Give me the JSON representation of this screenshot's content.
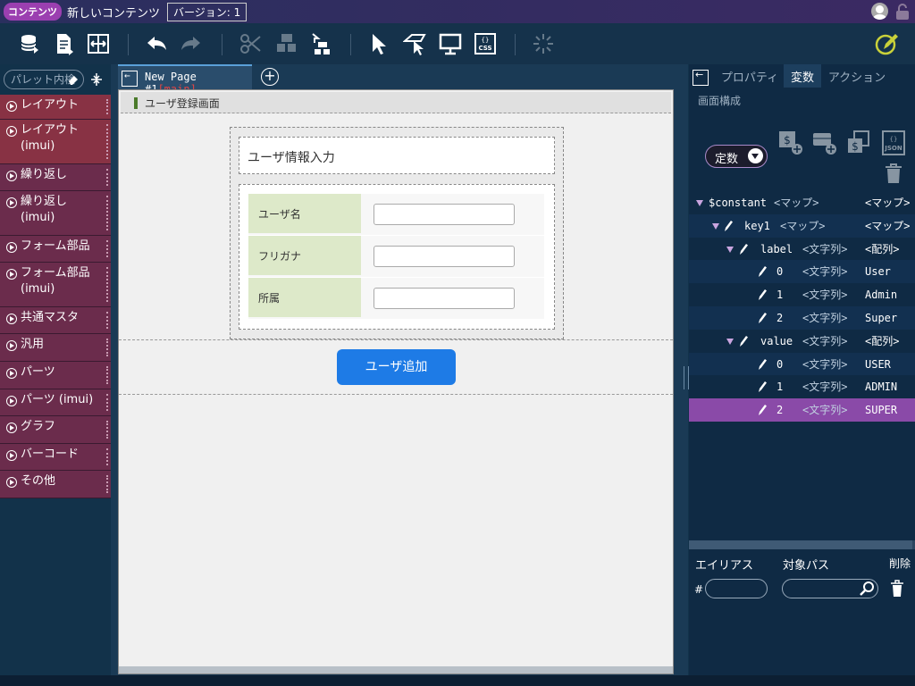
{
  "titlebar": {
    "badge": "コンテンツ",
    "title": "新しいコンテンツ",
    "version": "バージョン: 1",
    "icons": [
      "user-icon",
      "lock-icon"
    ]
  },
  "toolbar": {
    "buttons": [
      "database-icon",
      "document-icon",
      "resize-icon",
      "undo-icon",
      "redo-icon",
      "cut-icon",
      "copy-icon",
      "paste-icon",
      "select-icon",
      "pointer-icon",
      "preview-icon",
      "css-icon",
      "loading-icon",
      "edit-icon"
    ]
  },
  "palette": {
    "search_placeholder": "パレット内検",
    "items": [
      "レイアウト",
      "レイアウト\n(imui)",
      "繰り返し",
      "繰り返し\n(imui)",
      "フォーム部品",
      "フォーム部品\n(imui)",
      "共通マスタ",
      "汎用",
      "パーツ",
      "パーツ (imui)",
      "グラフ",
      "バーコード",
      "その他"
    ]
  },
  "editor": {
    "page_tab_name": "New Page #1",
    "page_tab_tag": "[main]",
    "screen_header": "ユーザ登録画面",
    "form_title": "ユーザ情報入力",
    "fields": [
      "ユーザ名",
      "フリガナ",
      "所属"
    ],
    "submit_button": "ユーザ追加"
  },
  "right_panel": {
    "tabs": [
      "プロパティ",
      "変数",
      "アクション"
    ],
    "active_tab": "変数",
    "sub_tab": "画面構成",
    "scope_select": "定数",
    "tree": [
      {
        "key": "$constant",
        "type": "<マップ>",
        "value": "<マップ>",
        "level": 0,
        "expand": true,
        "pen": false
      },
      {
        "key": "key1",
        "type": "<マップ>",
        "value": "<マップ>",
        "level": 1,
        "expand": true,
        "pen": true
      },
      {
        "key": "label",
        "type": "<文字列>",
        "value": "<配列>",
        "level": 2,
        "expand": true,
        "pen": true
      },
      {
        "key": "0",
        "type": "<文字列>",
        "value": "User",
        "level": 3,
        "expand": false,
        "pen": true
      },
      {
        "key": "1",
        "type": "<文字列>",
        "value": "Admin",
        "level": 3,
        "expand": false,
        "pen": true
      },
      {
        "key": "2",
        "type": "<文字列>",
        "value": "Super",
        "level": 3,
        "expand": false,
        "pen": true
      },
      {
        "key": "value",
        "type": "<文字列>",
        "value": "<配列>",
        "level": 2,
        "expand": true,
        "pen": true
      },
      {
        "key": "0",
        "type": "<文字列>",
        "value": "USER",
        "level": 3,
        "expand": false,
        "pen": true
      },
      {
        "key": "1",
        "type": "<文字列>",
        "value": "ADMIN",
        "level": 3,
        "expand": false,
        "pen": true
      },
      {
        "key": "2",
        "type": "<文字列>",
        "value": "SUPER",
        "level": 3,
        "expand": false,
        "pen": true,
        "selected": true
      }
    ],
    "alias_label": "エイリアス",
    "path_label": "対象パス",
    "delete_label": "削除",
    "alias_prefix": "#"
  },
  "colors": {
    "accent": "#8a4aa8",
    "button": "#1e7be6",
    "palette_item": "#6b2c4c",
    "form_label_bg": "#dde9c9"
  }
}
